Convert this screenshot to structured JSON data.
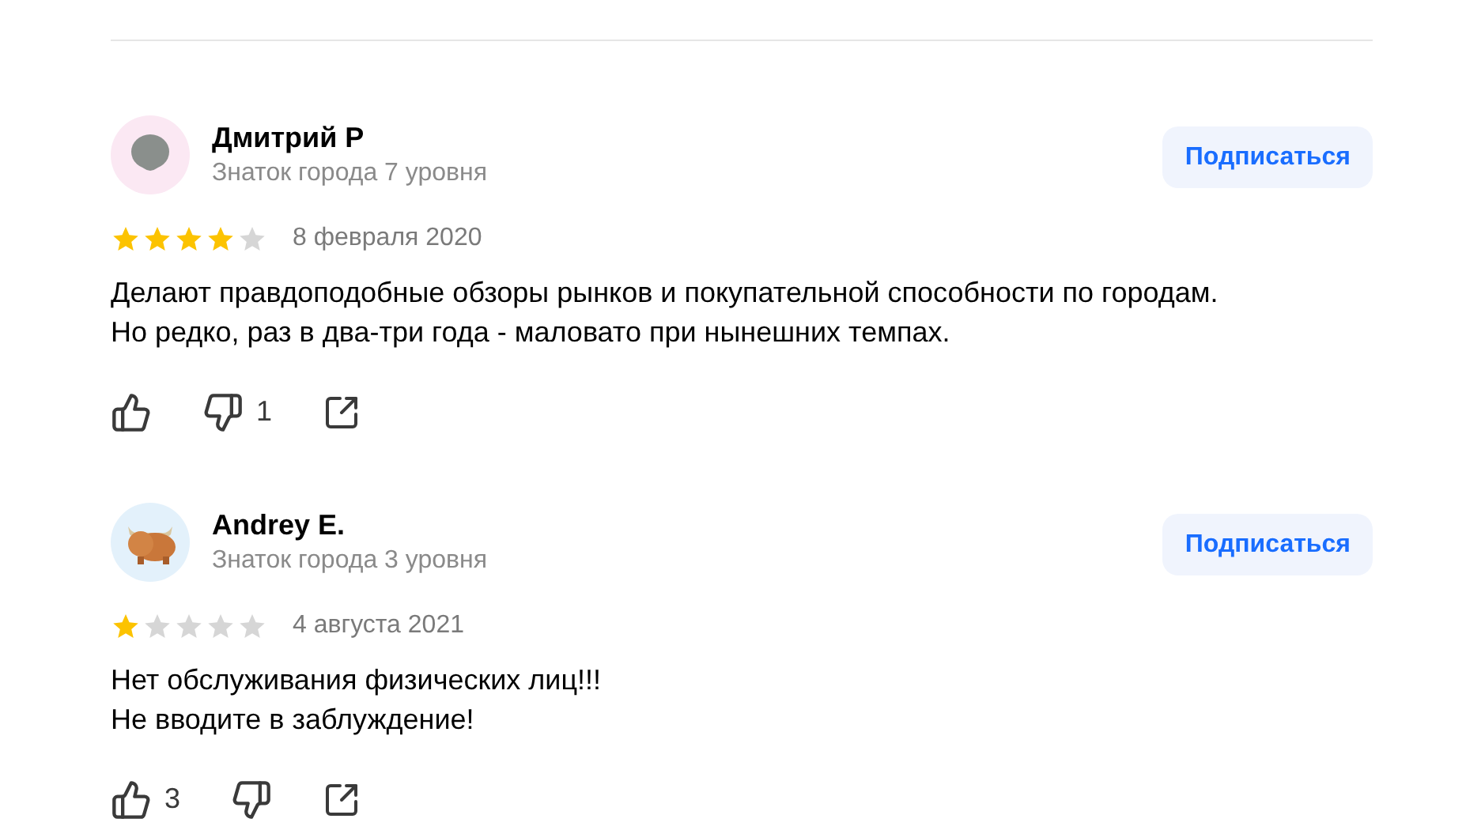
{
  "reviews": [
    {
      "author": "Дмитрий Р",
      "level": "Знаток города 7 уровня",
      "avatar": {
        "kind": "alien",
        "color": "#fbe8f3"
      },
      "subscribe": "Подписаться",
      "stars": 4,
      "date": "8 февраля 2020",
      "text": [
        "Делают правдоподобные обзоры рынков и покупательной способности по городам.",
        "Но редко, раз в два-три года - маловато при нынешних темпах."
      ],
      "dislikes": "1"
    },
    {
      "author": "Andrey E.",
      "level": "Знаток города 3 уровня",
      "avatar": {
        "kind": "yak",
        "color": "#e3f1fb"
      },
      "subscribe": "Подписаться",
      "stars": 1,
      "date": "4 августа 2021",
      "text": [
        "Нет обслуживания физических лиц!!!",
        "Не вводите в заблуждение!"
      ],
      "likes": "3"
    }
  ]
}
